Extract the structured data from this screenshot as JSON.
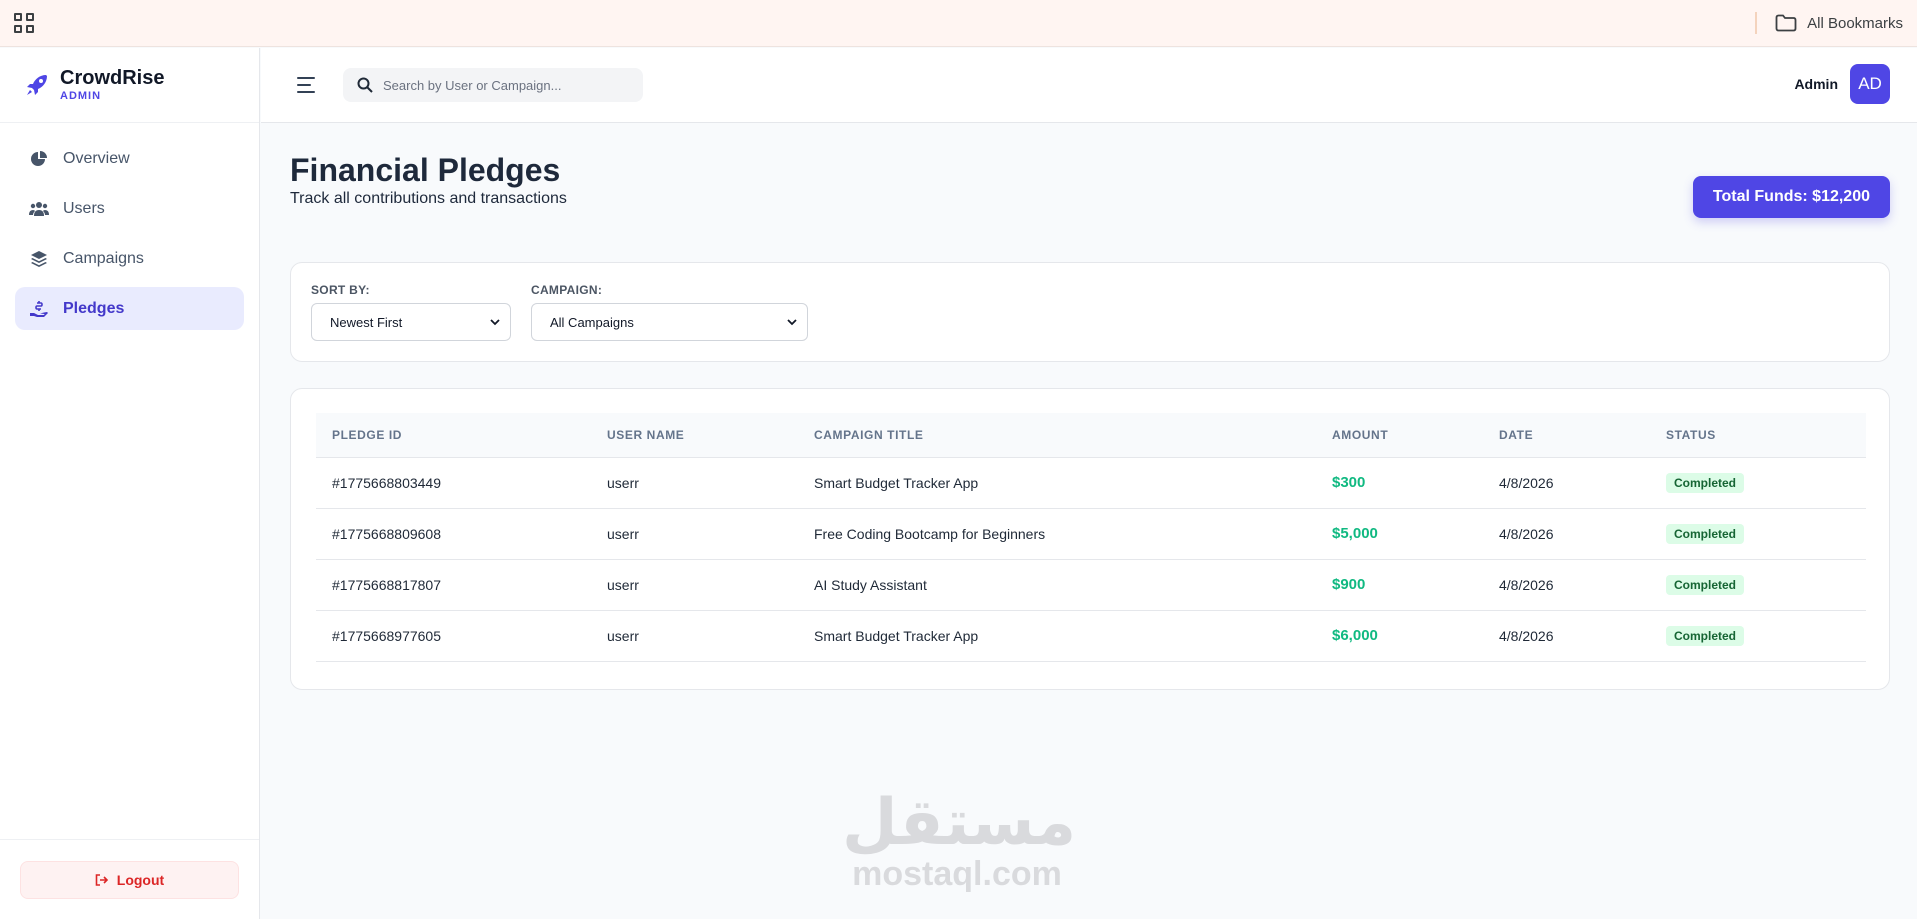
{
  "browser": {
    "bookmarks_label": "All Bookmarks"
  },
  "brand": {
    "name": "CrowdRise",
    "subtitle": "ADMIN",
    "accent_color": "#4f46e5"
  },
  "sidebar": {
    "items": [
      {
        "label": "Overview",
        "icon": "pie-chart-icon",
        "active": false
      },
      {
        "label": "Users",
        "icon": "users-icon",
        "active": false
      },
      {
        "label": "Campaigns",
        "icon": "layers-icon",
        "active": false
      },
      {
        "label": "Pledges",
        "icon": "hand-coin-icon",
        "active": true
      }
    ],
    "logout_label": "Logout"
  },
  "header": {
    "search_placeholder": "Search by User or Campaign...",
    "user_label": "Admin",
    "avatar_initials": "AD"
  },
  "page": {
    "title": "Financial Pledges",
    "subtitle": "Track all contributions and transactions",
    "total_funds": "Total Funds: $12,200"
  },
  "filters": {
    "sort_label": "SORT BY:",
    "sort_value": "Newest First",
    "campaign_label": "CAMPAIGN:",
    "campaign_value": "All Campaigns"
  },
  "table": {
    "columns": [
      "PLEDGE ID",
      "USER NAME",
      "CAMPAIGN TITLE",
      "AMOUNT",
      "DATE",
      "STATUS"
    ],
    "rows": [
      {
        "id": "#1775668803449",
        "user": "userr",
        "campaign": "Smart Budget Tracker App",
        "amount": "$300",
        "date": "4/8/2026",
        "status": "Completed"
      },
      {
        "id": "#1775668809608",
        "user": "userr",
        "campaign": "Free Coding Bootcamp for Beginners",
        "amount": "$5,000",
        "date": "4/8/2026",
        "status": "Completed"
      },
      {
        "id": "#1775668817807",
        "user": "userr",
        "campaign": "AI Study Assistant",
        "amount": "$900",
        "date": "4/8/2026",
        "status": "Completed"
      },
      {
        "id": "#1775668977605",
        "user": "userr",
        "campaign": "Smart Budget Tracker App",
        "amount": "$6,000",
        "date": "4/8/2026",
        "status": "Completed"
      }
    ]
  },
  "watermark": {
    "arabic": "مستقل",
    "latin": "mostaql.com"
  }
}
